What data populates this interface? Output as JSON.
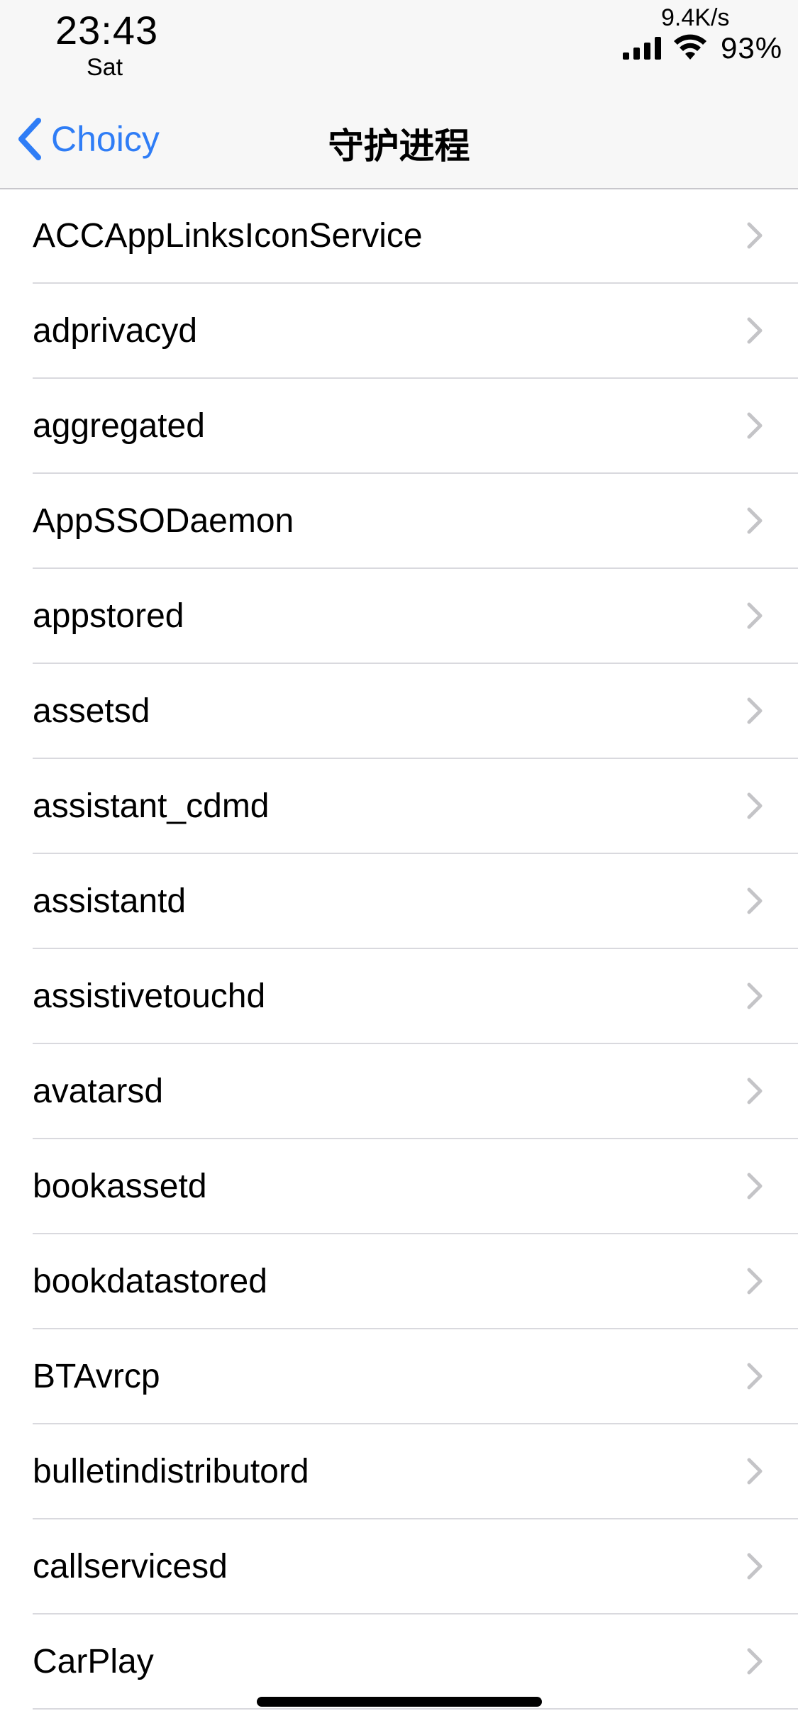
{
  "status_bar": {
    "time": "23:43",
    "day": "Sat",
    "network_speed": "9.4K/s",
    "battery": "93%"
  },
  "nav": {
    "back_label": "Choicy",
    "title": "守护进程"
  },
  "list": {
    "items": [
      "ACCAppLinksIconService",
      "adprivacyd",
      "aggregated",
      "AppSSODaemon",
      "appstored",
      "assetsd",
      "assistant_cdmd",
      "assistantd",
      "assistivetouchd",
      "avatarsd",
      "bookassetd",
      "bookdatastored",
      "BTAvrcp",
      "bulletindistributord",
      "callservicesd",
      "CarPlay"
    ]
  },
  "colors": {
    "accent": "#2f7df6",
    "chevron": "#c4c4c7",
    "separator": "#d9d9de",
    "nav_background": "#f7f7f7"
  },
  "icons": {
    "back": "chevron-left-icon",
    "disclosure": "chevron-right-icon",
    "signal": "cellular-signal-icon",
    "wifi": "wifi-icon"
  }
}
